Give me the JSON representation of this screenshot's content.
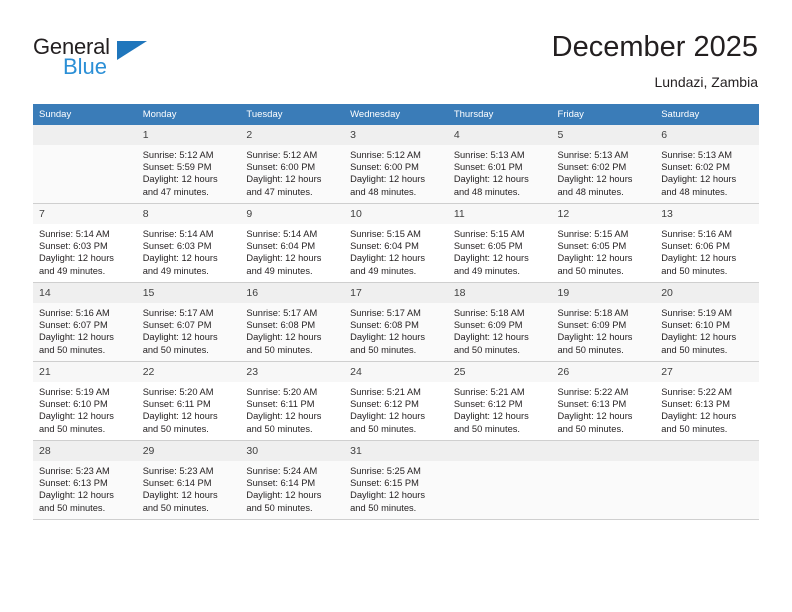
{
  "brand": {
    "name_top": "General",
    "name_bottom": "Blue",
    "accent_color": "#2b8fd6",
    "triangle_color": "#1f76bc"
  },
  "header": {
    "title": "December 2025",
    "subtitle": "Lundazi, Zambia"
  },
  "calendar": {
    "header_bg": "#3a7cb8",
    "weekdays": [
      "Sunday",
      "Monday",
      "Tuesday",
      "Wednesday",
      "Thursday",
      "Friday",
      "Saturday"
    ],
    "weeks": [
      [
        {
          "day": "",
          "sunrise": "",
          "sunset": "",
          "daylight_1": "",
          "daylight_2": ""
        },
        {
          "day": "1",
          "sunrise": "Sunrise: 5:12 AM",
          "sunset": "Sunset: 5:59 PM",
          "daylight_1": "Daylight: 12 hours",
          "daylight_2": "and 47 minutes."
        },
        {
          "day": "2",
          "sunrise": "Sunrise: 5:12 AM",
          "sunset": "Sunset: 6:00 PM",
          "daylight_1": "Daylight: 12 hours",
          "daylight_2": "and 47 minutes."
        },
        {
          "day": "3",
          "sunrise": "Sunrise: 5:12 AM",
          "sunset": "Sunset: 6:00 PM",
          "daylight_1": "Daylight: 12 hours",
          "daylight_2": "and 48 minutes."
        },
        {
          "day": "4",
          "sunrise": "Sunrise: 5:13 AM",
          "sunset": "Sunset: 6:01 PM",
          "daylight_1": "Daylight: 12 hours",
          "daylight_2": "and 48 minutes."
        },
        {
          "day": "5",
          "sunrise": "Sunrise: 5:13 AM",
          "sunset": "Sunset: 6:02 PM",
          "daylight_1": "Daylight: 12 hours",
          "daylight_2": "and 48 minutes."
        },
        {
          "day": "6",
          "sunrise": "Sunrise: 5:13 AM",
          "sunset": "Sunset: 6:02 PM",
          "daylight_1": "Daylight: 12 hours",
          "daylight_2": "and 48 minutes."
        }
      ],
      [
        {
          "day": "7",
          "sunrise": "Sunrise: 5:14 AM",
          "sunset": "Sunset: 6:03 PM",
          "daylight_1": "Daylight: 12 hours",
          "daylight_2": "and 49 minutes."
        },
        {
          "day": "8",
          "sunrise": "Sunrise: 5:14 AM",
          "sunset": "Sunset: 6:03 PM",
          "daylight_1": "Daylight: 12 hours",
          "daylight_2": "and 49 minutes."
        },
        {
          "day": "9",
          "sunrise": "Sunrise: 5:14 AM",
          "sunset": "Sunset: 6:04 PM",
          "daylight_1": "Daylight: 12 hours",
          "daylight_2": "and 49 minutes."
        },
        {
          "day": "10",
          "sunrise": "Sunrise: 5:15 AM",
          "sunset": "Sunset: 6:04 PM",
          "daylight_1": "Daylight: 12 hours",
          "daylight_2": "and 49 minutes."
        },
        {
          "day": "11",
          "sunrise": "Sunrise: 5:15 AM",
          "sunset": "Sunset: 6:05 PM",
          "daylight_1": "Daylight: 12 hours",
          "daylight_2": "and 49 minutes."
        },
        {
          "day": "12",
          "sunrise": "Sunrise: 5:15 AM",
          "sunset": "Sunset: 6:05 PM",
          "daylight_1": "Daylight: 12 hours",
          "daylight_2": "and 50 minutes."
        },
        {
          "day": "13",
          "sunrise": "Sunrise: 5:16 AM",
          "sunset": "Sunset: 6:06 PM",
          "daylight_1": "Daylight: 12 hours",
          "daylight_2": "and 50 minutes."
        }
      ],
      [
        {
          "day": "14",
          "sunrise": "Sunrise: 5:16 AM",
          "sunset": "Sunset: 6:07 PM",
          "daylight_1": "Daylight: 12 hours",
          "daylight_2": "and 50 minutes."
        },
        {
          "day": "15",
          "sunrise": "Sunrise: 5:17 AM",
          "sunset": "Sunset: 6:07 PM",
          "daylight_1": "Daylight: 12 hours",
          "daylight_2": "and 50 minutes."
        },
        {
          "day": "16",
          "sunrise": "Sunrise: 5:17 AM",
          "sunset": "Sunset: 6:08 PM",
          "daylight_1": "Daylight: 12 hours",
          "daylight_2": "and 50 minutes."
        },
        {
          "day": "17",
          "sunrise": "Sunrise: 5:17 AM",
          "sunset": "Sunset: 6:08 PM",
          "daylight_1": "Daylight: 12 hours",
          "daylight_2": "and 50 minutes."
        },
        {
          "day": "18",
          "sunrise": "Sunrise: 5:18 AM",
          "sunset": "Sunset: 6:09 PM",
          "daylight_1": "Daylight: 12 hours",
          "daylight_2": "and 50 minutes."
        },
        {
          "day": "19",
          "sunrise": "Sunrise: 5:18 AM",
          "sunset": "Sunset: 6:09 PM",
          "daylight_1": "Daylight: 12 hours",
          "daylight_2": "and 50 minutes."
        },
        {
          "day": "20",
          "sunrise": "Sunrise: 5:19 AM",
          "sunset": "Sunset: 6:10 PM",
          "daylight_1": "Daylight: 12 hours",
          "daylight_2": "and 50 minutes."
        }
      ],
      [
        {
          "day": "21",
          "sunrise": "Sunrise: 5:19 AM",
          "sunset": "Sunset: 6:10 PM",
          "daylight_1": "Daylight: 12 hours",
          "daylight_2": "and 50 minutes."
        },
        {
          "day": "22",
          "sunrise": "Sunrise: 5:20 AM",
          "sunset": "Sunset: 6:11 PM",
          "daylight_1": "Daylight: 12 hours",
          "daylight_2": "and 50 minutes."
        },
        {
          "day": "23",
          "sunrise": "Sunrise: 5:20 AM",
          "sunset": "Sunset: 6:11 PM",
          "daylight_1": "Daylight: 12 hours",
          "daylight_2": "and 50 minutes."
        },
        {
          "day": "24",
          "sunrise": "Sunrise: 5:21 AM",
          "sunset": "Sunset: 6:12 PM",
          "daylight_1": "Daylight: 12 hours",
          "daylight_2": "and 50 minutes."
        },
        {
          "day": "25",
          "sunrise": "Sunrise: 5:21 AM",
          "sunset": "Sunset: 6:12 PM",
          "daylight_1": "Daylight: 12 hours",
          "daylight_2": "and 50 minutes."
        },
        {
          "day": "26",
          "sunrise": "Sunrise: 5:22 AM",
          "sunset": "Sunset: 6:13 PM",
          "daylight_1": "Daylight: 12 hours",
          "daylight_2": "and 50 minutes."
        },
        {
          "day": "27",
          "sunrise": "Sunrise: 5:22 AM",
          "sunset": "Sunset: 6:13 PM",
          "daylight_1": "Daylight: 12 hours",
          "daylight_2": "and 50 minutes."
        }
      ],
      [
        {
          "day": "28",
          "sunrise": "Sunrise: 5:23 AM",
          "sunset": "Sunset: 6:13 PM",
          "daylight_1": "Daylight: 12 hours",
          "daylight_2": "and 50 minutes."
        },
        {
          "day": "29",
          "sunrise": "Sunrise: 5:23 AM",
          "sunset": "Sunset: 6:14 PM",
          "daylight_1": "Daylight: 12 hours",
          "daylight_2": "and 50 minutes."
        },
        {
          "day": "30",
          "sunrise": "Sunrise: 5:24 AM",
          "sunset": "Sunset: 6:14 PM",
          "daylight_1": "Daylight: 12 hours",
          "daylight_2": "and 50 minutes."
        },
        {
          "day": "31",
          "sunrise": "Sunrise: 5:25 AM",
          "sunset": "Sunset: 6:15 PM",
          "daylight_1": "Daylight: 12 hours",
          "daylight_2": "and 50 minutes."
        },
        {
          "day": "",
          "sunrise": "",
          "sunset": "",
          "daylight_1": "",
          "daylight_2": ""
        },
        {
          "day": "",
          "sunrise": "",
          "sunset": "",
          "daylight_1": "",
          "daylight_2": ""
        },
        {
          "day": "",
          "sunrise": "",
          "sunset": "",
          "daylight_1": "",
          "daylight_2": ""
        }
      ]
    ]
  }
}
